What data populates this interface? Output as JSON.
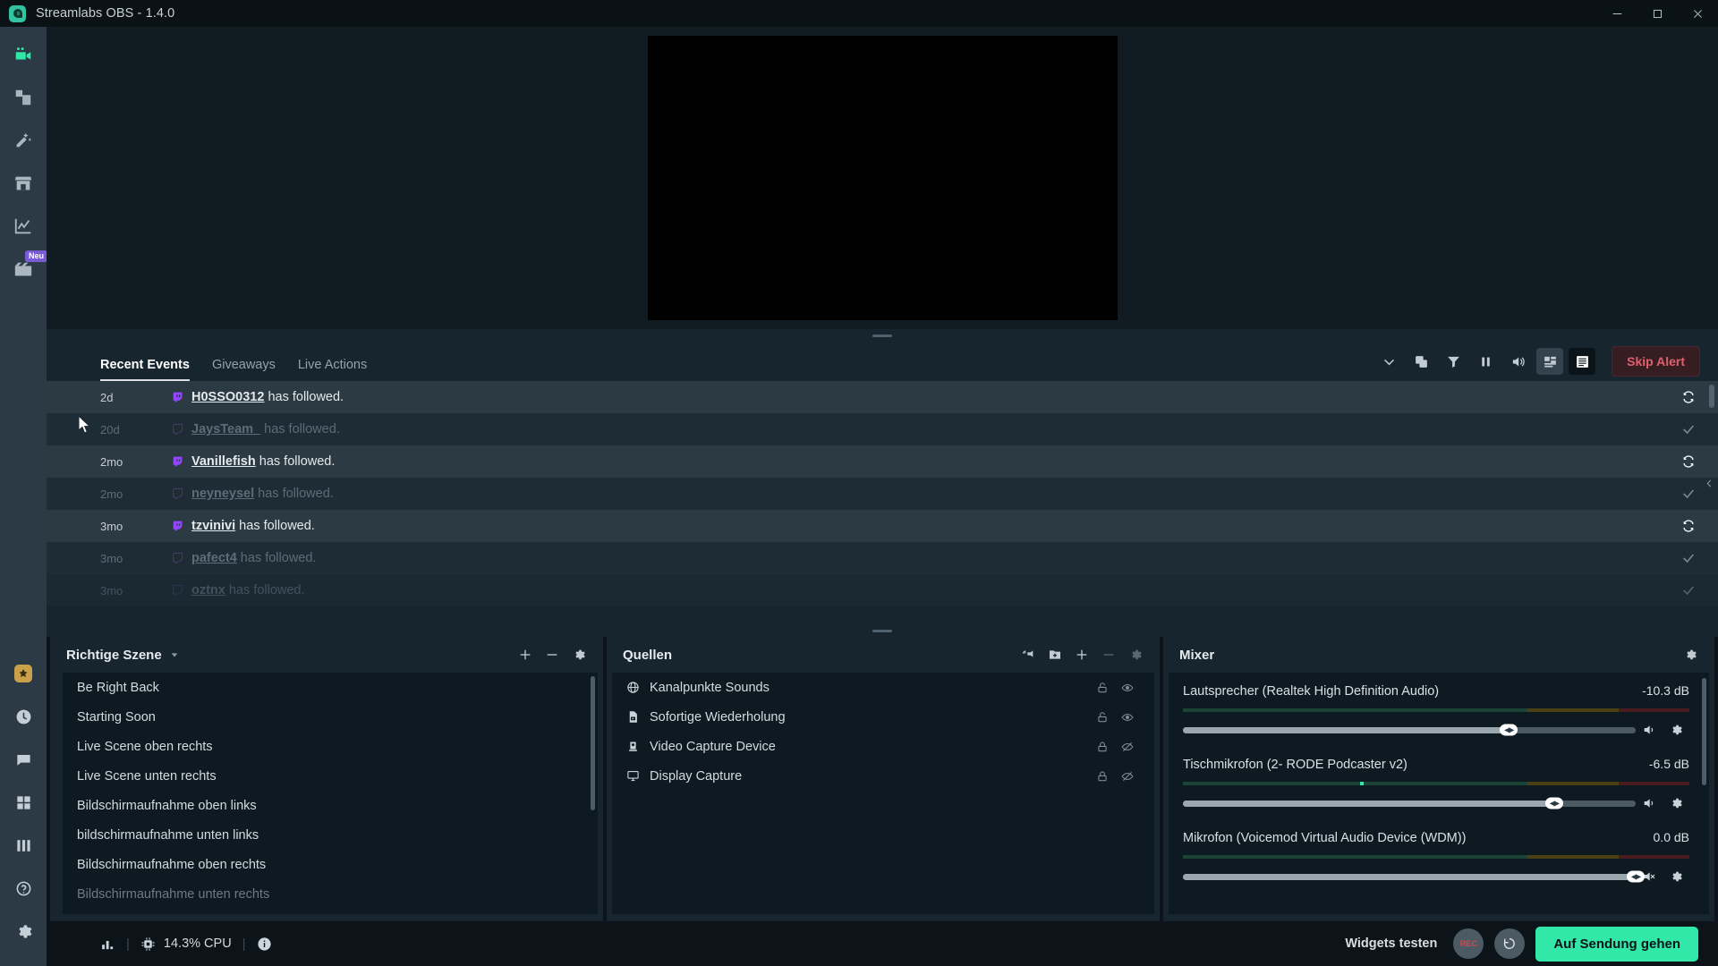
{
  "titlebar": {
    "title": "Streamlabs OBS - 1.4.0",
    "logo_icon": "streamlabs-logo-icon",
    "minimize_icon": "minimize-icon",
    "maximize_icon": "maximize-icon",
    "close_icon": "close-icon"
  },
  "sidebar": {
    "items": [
      {
        "name": "editor",
        "icon": "video-camera-icon",
        "active": true,
        "badge": ""
      },
      {
        "name": "themes",
        "icon": "layers-icon",
        "active": false,
        "badge": ""
      },
      {
        "name": "alertbox",
        "icon": "magic-wand-icon",
        "active": false,
        "badge": ""
      },
      {
        "name": "store",
        "icon": "store-icon",
        "active": false,
        "badge": ""
      },
      {
        "name": "dashboard",
        "icon": "line-chart-icon",
        "active": false,
        "badge": ""
      },
      {
        "name": "highlighter",
        "icon": "film-clapper-icon",
        "active": false,
        "badge": "Neu"
      }
    ],
    "bottom_items": [
      {
        "name": "prime",
        "icon": "prime-star-icon"
      },
      {
        "name": "recent-activity",
        "icon": "clock-icon"
      },
      {
        "name": "chat",
        "icon": "chat-bubble-icon"
      },
      {
        "name": "apps",
        "icon": "grid-apps-icon"
      },
      {
        "name": "mixer-bars",
        "icon": "bars-icon"
      },
      {
        "name": "help",
        "icon": "question-circle-icon"
      },
      {
        "name": "settings",
        "icon": "gear-icon"
      }
    ]
  },
  "events": {
    "tabs": [
      {
        "label": "Recent Events",
        "active": true
      },
      {
        "label": "Giveaways",
        "active": false
      },
      {
        "label": "Live Actions",
        "active": false
      }
    ],
    "toolbar": [
      {
        "name": "chevron-down",
        "icon": "chevron-down-icon",
        "state": "normal"
      },
      {
        "name": "duplicate",
        "icon": "copy-icon",
        "state": "normal"
      },
      {
        "name": "filter",
        "icon": "funnel-icon",
        "state": "normal"
      },
      {
        "name": "pause",
        "icon": "pause-icon",
        "state": "normal"
      },
      {
        "name": "volume",
        "icon": "speaker-icon",
        "state": "normal"
      },
      {
        "name": "compact-view",
        "icon": "compact-view-icon",
        "state": "boxed"
      },
      {
        "name": "list-view",
        "icon": "list-view-icon",
        "state": "boxed-dark"
      }
    ],
    "skip_alert_label": "Skip Alert",
    "rows": [
      {
        "time": "2d",
        "platform": "twitch-icon",
        "user": "H0SSO0312",
        "text": " has followed.",
        "action": "replay-icon",
        "highlight": true
      },
      {
        "time": "20d",
        "platform": "twitch-icon",
        "user": "JaysTeam_",
        "text": " has followed.",
        "action": "check-icon",
        "highlight": false
      },
      {
        "time": "2mo",
        "platform": "twitch-icon",
        "user": "Vanillefish",
        "text": " has followed.",
        "action": "replay-icon",
        "highlight": true
      },
      {
        "time": "2mo",
        "platform": "twitch-icon",
        "user": "neyneysel",
        "text": " has followed.",
        "action": "check-icon",
        "highlight": false
      },
      {
        "time": "3mo",
        "platform": "twitch-icon",
        "user": "tzvinivi",
        "text": " has followed.",
        "action": "replay-icon",
        "highlight": true
      },
      {
        "time": "3mo",
        "platform": "twitch-icon",
        "user": "pafect4",
        "text": " has followed.",
        "action": "check-icon",
        "highlight": false
      },
      {
        "time": "3mo",
        "platform": "twitch-icon",
        "user": "oztnx",
        "text": " has followed.",
        "action": "check-icon",
        "highlight": false
      }
    ]
  },
  "scenes": {
    "title": "Richtige Szene",
    "caret_icon": "chevron-down-icon",
    "tools": [
      {
        "name": "add-scene",
        "icon": "plus-icon"
      },
      {
        "name": "remove-scene",
        "icon": "minus-icon"
      },
      {
        "name": "scene-settings",
        "icon": "gear-icon"
      }
    ],
    "items": [
      {
        "label": "Be Right Back"
      },
      {
        "label": "Starting Soon"
      },
      {
        "label": "Live Scene oben rechts"
      },
      {
        "label": "Live Scene unten rechts"
      },
      {
        "label": "Bildschirmaufnahme oben links"
      },
      {
        "label": "bildschirmaufnahme unten links"
      },
      {
        "label": "Bildschirmaufnahme oben rechts"
      },
      {
        "label": "Bildschirmaufnahme unten rechts"
      }
    ]
  },
  "sources": {
    "title": "Quellen",
    "tools": [
      {
        "name": "audio-monitor",
        "icon": "audio-wave-icon"
      },
      {
        "name": "add-folder",
        "icon": "folder-plus-icon"
      },
      {
        "name": "add-source",
        "icon": "plus-icon"
      },
      {
        "name": "remove-source",
        "icon": "minus-icon"
      },
      {
        "name": "source-settings",
        "icon": "gear-icon"
      }
    ],
    "items": [
      {
        "label": "Kanalpunkte Sounds",
        "icon": "globe-icon",
        "lock": "unlock-icon",
        "visibility": "eye-icon"
      },
      {
        "label": "Sofortige Wiederholung",
        "icon": "media-file-icon",
        "lock": "unlock-icon",
        "visibility": "eye-icon"
      },
      {
        "label": "Video Capture Device",
        "icon": "webcam-icon",
        "lock": "lock-icon",
        "visibility": "eye-slash-icon"
      },
      {
        "label": "Display Capture",
        "icon": "monitor-icon",
        "lock": "lock-icon",
        "visibility": "eye-slash-icon"
      }
    ]
  },
  "mixer": {
    "title": "Mixer",
    "settings_icon": "gear-icon",
    "channels": [
      {
        "name": "Lautsprecher (Realtek High Definition Audio)",
        "db": "-10.3 dB",
        "volume_percent": 72,
        "peak_percent": 0,
        "mute_icon": "speaker-icon",
        "settings_icon": "gear-icon"
      },
      {
        "name": "Tischmikrofon (2- RODE Podcaster v2)",
        "db": "-6.5 dB",
        "volume_percent": 82,
        "peak_percent": 35,
        "mute_icon": "speaker-icon",
        "settings_icon": "gear-icon"
      },
      {
        "name": "Mikrofon (Voicemod Virtual Audio Device (WDM))",
        "db": "0.0 dB",
        "volume_percent": 100,
        "peak_percent": 0,
        "mute_icon": "speaker-muted-icon",
        "settings_icon": "gear-icon"
      }
    ]
  },
  "statusbar": {
    "performance_icon": "bar-chart-icon",
    "cpu_icon": "cpu-chip-icon",
    "cpu_text": "14.3% CPU",
    "info_icon": "info-circle-icon",
    "widgets_label": "Widgets testen",
    "rec_label": "REC",
    "replay_icon": "replay-buffer-icon",
    "golive_label": "Auf Sendung gehen"
  },
  "colors": {
    "accent_green": "#31e8a8",
    "twitch_purple": "#9146ff",
    "skip_red": "#e0616e",
    "panel_bg": "#17252e",
    "list_bg": "#0e1a21",
    "sidebar_bg": "#2b3a44",
    "badge_purple": "#7a5bd6"
  }
}
